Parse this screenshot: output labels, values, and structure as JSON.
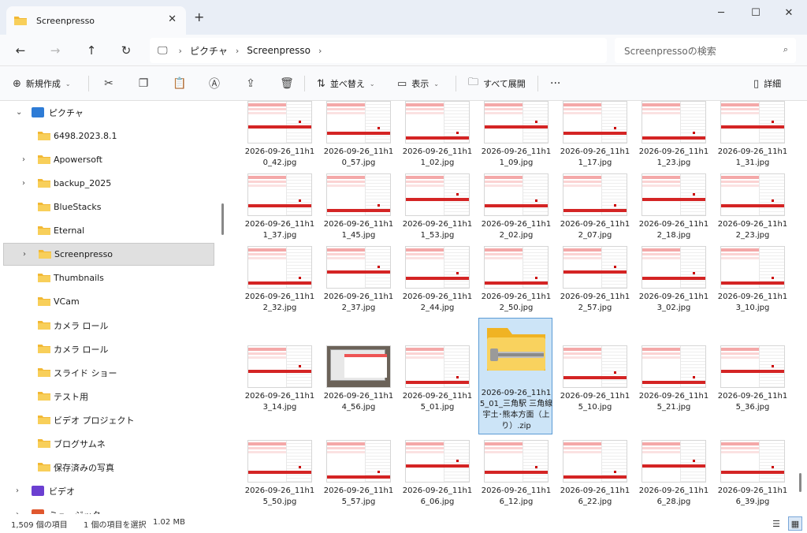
{
  "window": {
    "tab_title": "Screenpresso",
    "tab_close_icon": "close-icon",
    "new_tab_icon": "plus-icon",
    "controls": [
      "minimize-icon",
      "maximize-icon",
      "close-icon"
    ]
  },
  "address": {
    "crumbs": [
      "ピクチャ",
      "Screenpresso"
    ],
    "search_placeholder": "Screenpressoの検索"
  },
  "toolbar": {
    "new_label": "新規作成",
    "sort_label": "並べ替え",
    "view_label": "表示",
    "expand_label": "すべて展開",
    "details_label": "詳細",
    "more_label": "···"
  },
  "sidebar": {
    "root": {
      "label": "ピクチャ"
    },
    "items": [
      {
        "label": "6498.2023.8.1",
        "chevron": false
      },
      {
        "label": "Apowersoft",
        "chevron": true
      },
      {
        "label": "backup_2025",
        "chevron": true
      },
      {
        "label": "BlueStacks",
        "chevron": false
      },
      {
        "label": "Eternal",
        "chevron": false
      },
      {
        "label": "Screenpresso",
        "chevron": true
      },
      {
        "label": "Thumbnails",
        "chevron": false
      },
      {
        "label": "VCam",
        "chevron": false
      },
      {
        "label": "カメラ ロール",
        "chevron": false
      },
      {
        "label": "カメラ ロール",
        "chevron": false
      },
      {
        "label": "スライド ショー",
        "chevron": false
      },
      {
        "label": "テスト用",
        "chevron": false
      },
      {
        "label": "ビデオ プロジェクト",
        "chevron": false
      },
      {
        "label": "ブログサムネ",
        "chevron": false
      },
      {
        "label": "保存済みの写真",
        "chevron": false
      }
    ],
    "video": {
      "label": "ビデオ"
    },
    "music": {
      "label": "ミュージック"
    }
  },
  "files": [
    {
      "name": "2026-09-26_11h10_42.jpg",
      "kind": "img"
    },
    {
      "name": "2026-09-26_11h10_57.jpg",
      "kind": "img"
    },
    {
      "name": "2026-09-26_11h11_02.jpg",
      "kind": "img"
    },
    {
      "name": "2026-09-26_11h11_09.jpg",
      "kind": "img"
    },
    {
      "name": "2026-09-26_11h11_17.jpg",
      "kind": "img"
    },
    {
      "name": "2026-09-26_11h11_23.jpg",
      "kind": "img"
    },
    {
      "name": "2026-09-26_11h11_31.jpg",
      "kind": "img"
    },
    {
      "name": "2026-09-26_11h11_37.jpg",
      "kind": "img"
    },
    {
      "name": "2026-09-26_11h11_45.jpg",
      "kind": "img"
    },
    {
      "name": "2026-09-26_11h11_53.jpg",
      "kind": "img"
    },
    {
      "name": "2026-09-26_11h12_02.jpg",
      "kind": "img"
    },
    {
      "name": "2026-09-26_11h12_07.jpg",
      "kind": "img"
    },
    {
      "name": "2026-09-26_11h12_18.jpg",
      "kind": "img"
    },
    {
      "name": "2026-09-26_11h12_23.jpg",
      "kind": "img"
    },
    {
      "name": "2026-09-26_11h12_32.jpg",
      "kind": "img"
    },
    {
      "name": "2026-09-26_11h12_37.jpg",
      "kind": "img"
    },
    {
      "name": "2026-09-26_11h12_44.jpg",
      "kind": "img"
    },
    {
      "name": "2026-09-26_11h12_50.jpg",
      "kind": "img"
    },
    {
      "name": "2026-09-26_11h12_57.jpg",
      "kind": "img"
    },
    {
      "name": "2026-09-26_11h13_02.jpg",
      "kind": "img"
    },
    {
      "name": "2026-09-26_11h13_10.jpg",
      "kind": "img"
    },
    {
      "name": "2026-09-26_11h13_14.jpg",
      "kind": "img"
    },
    {
      "name": "2026-09-26_11h14_56.jpg",
      "kind": "photo"
    },
    {
      "name": "2026-09-26_11h15_01.jpg",
      "kind": "img"
    },
    {
      "name": "2026-09-26_11h15_01_三角駅 三角線 宇土･熊本方面（上り）.zip",
      "kind": "zip",
      "selected": true
    },
    {
      "name": "2026-09-26_11h15_10.jpg",
      "kind": "img"
    },
    {
      "name": "2026-09-26_11h15_21.jpg",
      "kind": "img"
    },
    {
      "name": "2026-09-26_11h15_36.jpg",
      "kind": "img"
    },
    {
      "name": "2026-09-26_11h15_50.jpg",
      "kind": "img"
    },
    {
      "name": "2026-09-26_11h15_57.jpg",
      "kind": "img"
    },
    {
      "name": "2026-09-26_11h16_06.jpg",
      "kind": "img"
    },
    {
      "name": "2026-09-26_11h16_12.jpg",
      "kind": "img"
    },
    {
      "name": "2026-09-26_11h16_22.jpg",
      "kind": "img"
    },
    {
      "name": "2026-09-26_11h16_28.jpg",
      "kind": "img"
    },
    {
      "name": "2026-09-26_11h16_39.jpg",
      "kind": "img"
    }
  ],
  "status": {
    "count": "1,509 個の項目",
    "selection": "1 個の項目を選択",
    "size": "1.02 MB"
  },
  "colors": {
    "accent": "#0067c0",
    "selected_bg": "#cce4f7",
    "folder": "#f8c94a"
  }
}
